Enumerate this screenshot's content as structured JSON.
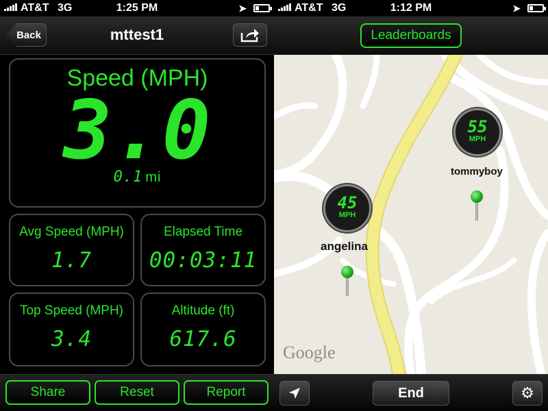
{
  "status_left": {
    "carrier": "AT&T",
    "network": "3G",
    "time": "1:25 PM"
  },
  "status_right": {
    "carrier": "AT&T",
    "network": "3G",
    "time": "1:12 PM"
  },
  "nav": {
    "back_label": "Back",
    "title": "mttest1"
  },
  "speed": {
    "label": "Speed (MPH)",
    "value": "3.0",
    "distance": "0.1",
    "distance_unit": "mi"
  },
  "stats": {
    "avg_label": "Avg Speed (MPH)",
    "avg_value": "1.7",
    "elapsed_label": "Elapsed Time",
    "elapsed_value": "00:03:11",
    "top_label": "Top Speed (MPH)",
    "top_value": "3.4",
    "alt_label": "Altitude (ft)",
    "alt_value": "617.6"
  },
  "toolbar": {
    "share_label": "Share",
    "reset_label": "Reset",
    "report_label": "Report"
  },
  "map_screen": {
    "leaderboards_label": "Leaderboards",
    "riders": [
      {
        "name": "tommyboy",
        "speed": "55",
        "unit": "MPH"
      },
      {
        "name": "angelina",
        "speed": "45",
        "unit": "MPH"
      }
    ],
    "map_logo": "Google",
    "end_label": "End"
  },
  "colors": {
    "accent": "#2be52b",
    "road_highlight": "#f3ec8a",
    "map_bg": "#ece9e0"
  },
  "icons": {
    "share": "share-arrow-icon",
    "location": "location-arrow-icon",
    "settings": "gear-icon"
  }
}
